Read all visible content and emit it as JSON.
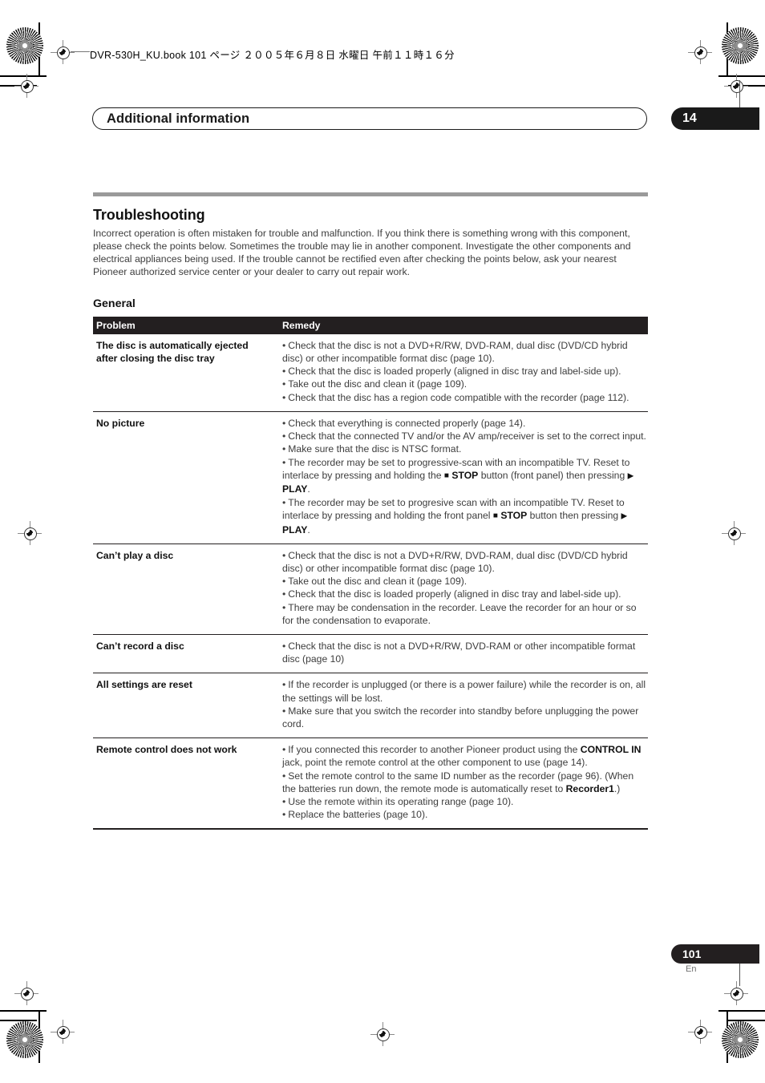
{
  "printer_header": {
    "filename": "DVR-530H_KU.book",
    "page_label": "101 ページ",
    "date": "２００５年６月８日",
    "weekday": "水曜日",
    "time": "午前１１時１６分",
    "full_line": "DVR-530H_KU.book  101 ページ  ２００５年６月８日   水曜日   午前１１時１６分"
  },
  "chapter": {
    "title": "Additional information",
    "number": "14"
  },
  "section": {
    "title": "Troubleshooting",
    "intro": "Incorrect operation is often mistaken for trouble and malfunction. If you think there is something wrong with this component, please check the points below. Sometimes the trouble may lie in another component. Investigate the other components and electrical appliances being used. If the trouble cannot be rectified even after checking the points below, ask your nearest Pioneer authorized service center or your dealer to carry out repair work.",
    "subsection_title": "General"
  },
  "table": {
    "headers": {
      "problem": "Problem",
      "remedy": "Remedy"
    },
    "rows": [
      {
        "problem": "The disc is automatically ejected after closing the disc tray",
        "remedy_lines": [
          "Check that the disc is not a DVD+R/RW, DVD-RAM, dual disc (DVD/CD hybrid disc) or other incompatible format disc (page 10).",
          "Check that the disc is loaded properly (aligned in disc tray and label-side up).",
          "Take out the disc and clean it (page 109).",
          "Check that the disc has a region code compatible with the recorder (page 112)."
        ]
      },
      {
        "problem": "No picture",
        "remedy_lines": [
          "Check that everything is connected properly (page 14).",
          "Check that the connected TV and/or the AV amp/receiver is set to the correct input.",
          "Make sure that the disc is NTSC format."
        ],
        "remedy_rich": {
          "item4_part1": "The recorder may be set to progressive-scan with an incompatible TV. Reset to interlace by pressing and holding the ",
          "item4_stop": "STOP",
          "item4_part2": " button (front panel) then pressing ",
          "item4_play": "PLAY",
          "item4_part3": ".",
          "item5_part1": "The recorder may be set to progresive scan with an incompatible TV. Reset to interlace by pressing and holding the front panel ",
          "item5_stop": "STOP",
          "item5_part2": " button then pressing ",
          "item5_play": "PLAY",
          "item5_part3": "."
        }
      },
      {
        "problem": "Can’t play a disc",
        "remedy_lines": [
          "Check that the disc is not a DVD+R/RW, DVD-RAM, dual disc (DVD/CD hybrid disc) or other incompatible format disc (page 10).",
          "Take out the disc and clean it (page 109).",
          "Check that the disc is loaded properly (aligned in disc tray and label-side up).",
          "There may be condensation in the recorder. Leave the recorder for an hour or so for the condensation to evaporate."
        ]
      },
      {
        "problem": "Can’t record a disc",
        "remedy_lines": [
          "Check that the disc is not a DVD+R/RW, DVD-RAM or other incompatible format disc (page 10)"
        ]
      },
      {
        "problem": "All settings are reset",
        "remedy_lines": [
          "If the recorder is unplugged (or there is a power failure) while the recorder is on, all the settings will be lost.",
          "Make sure that you switch the recorder into standby before unplugging the power cord."
        ]
      },
      {
        "problem": "Remote control does not work",
        "remedy_lines": [
          "Use the remote within its operating range (page 10).",
          "Replace the batteries (page 10)."
        ],
        "remedy_rich": {
          "item1_part1": "If you connected this recorder to another Pioneer product using the ",
          "item1_bold": "CONTROL IN",
          "item1_part2": " jack, point the remote control at the other component to use (page 14).",
          "item2_part1": "Set the remote control to the same ID number as the recorder (page 96). (When the batteries run down, the remote mode is automatically reset to ",
          "item2_bold": "Recorder1",
          "item2_part2": ".)"
        }
      }
    ]
  },
  "footer": {
    "page_number": "101",
    "language": "En"
  },
  "colors": {
    "header_bar": "#231f20",
    "section_rule": "#9a9a9a",
    "body_text": "#3d3d3d",
    "heading_text": "#111111"
  },
  "icons": {
    "stop": "■",
    "play": "▶",
    "bullet": "•"
  }
}
